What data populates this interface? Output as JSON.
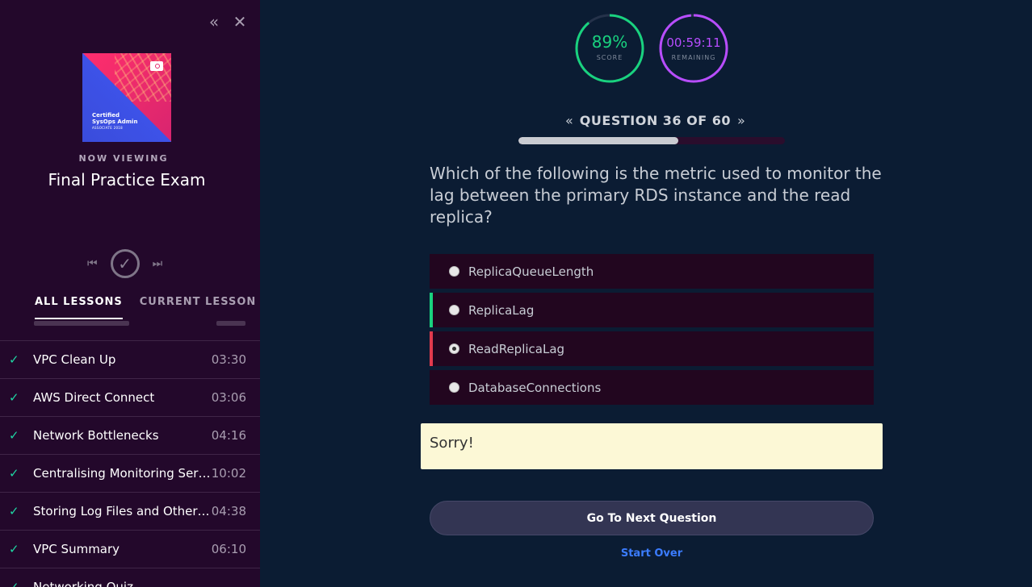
{
  "sidebar": {
    "collapse_icon": "double-chevron-left-icon",
    "close_icon": "close-icon",
    "cover": {
      "line1": "Certified",
      "line2": "SysOps Admin",
      "line3": "ASSOCIATE 2018"
    },
    "now_viewing_label": "NOW VIEWING",
    "lesson_title": "Final Practice Exam",
    "tabs": [
      {
        "label": "ALL LESSONS",
        "active": true
      },
      {
        "label": "CURRENT LESSON",
        "active": false
      }
    ],
    "lessons": [
      {
        "name": "VPC Clean Up",
        "duration": "03:30",
        "completed": true
      },
      {
        "name": "AWS Direct Connect",
        "duration": "03:06",
        "completed": true
      },
      {
        "name": "Network Bottlenecks",
        "duration": "04:16",
        "completed": true
      },
      {
        "name": "Centralising Monitoring Servers",
        "duration": "10:02",
        "completed": true
      },
      {
        "name": "Storing Log Files and Other Ba...",
        "duration": "04:38",
        "completed": true
      },
      {
        "name": "VPC Summary",
        "duration": "06:10",
        "completed": true
      },
      {
        "name": "Networking Quiz",
        "duration": "",
        "completed": true
      }
    ]
  },
  "stats": {
    "score_value": "89%",
    "score_label": "SCORE",
    "score_fraction": 0.89,
    "time_value": "00:59:11",
    "time_label": "REMAINING",
    "time_fraction": 0.986,
    "colors": {
      "score": "#19d27f",
      "time": "#b84dff"
    }
  },
  "question_nav": {
    "text": "QUESTION 36 OF 60",
    "current": 36,
    "total": 60,
    "progress_fraction": 0.6
  },
  "question": {
    "text": "Which of the following is the metric used to monitor the lag between the primary RDS instance and the read replica?",
    "answers": [
      {
        "text": "ReplicaQueueLength",
        "state": "none",
        "selected": false
      },
      {
        "text": "ReplicaLag",
        "state": "correct",
        "selected": false
      },
      {
        "text": "ReadReplicaLag",
        "state": "wrong",
        "selected": true
      },
      {
        "text": "DatabaseConnections",
        "state": "none",
        "selected": false
      }
    ]
  },
  "feedback": {
    "text": "Sorry!"
  },
  "actions": {
    "next_label": "Go To Next Question",
    "start_over_label": "Start Over"
  }
}
